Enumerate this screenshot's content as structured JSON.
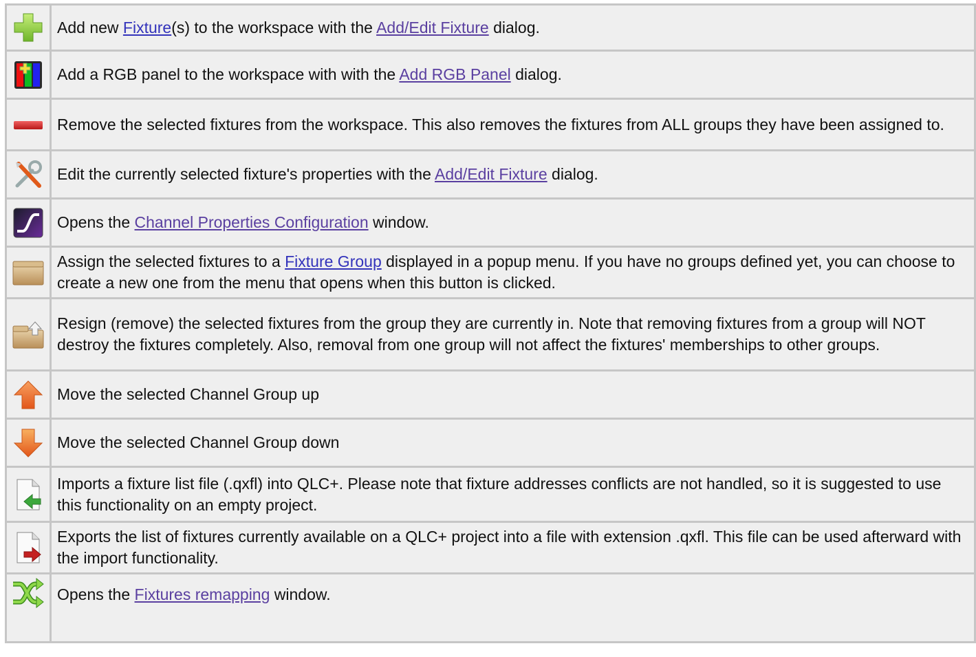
{
  "rows": [
    {
      "icon": "add-plus-icon",
      "parts": [
        "Add new ",
        "Fixture",
        "(s) to the workspace with the ",
        "Add/Edit Fixture",
        " dialog."
      ]
    },
    {
      "icon": "rgb-panel-icon",
      "parts": [
        "Add a RGB panel to the workspace with with the ",
        "Add RGB Panel",
        " dialog."
      ]
    },
    {
      "icon": "remove-minus-icon",
      "text": "Remove the selected fixtures from the workspace. This also removes the fixtures from ALL groups they have been assigned to."
    },
    {
      "icon": "configure-tools-icon",
      "parts": [
        "Edit the currently selected fixture's properties with the ",
        "Add/Edit Fixture",
        " dialog."
      ]
    },
    {
      "icon": "channel-properties-icon",
      "parts": [
        "Opens the ",
        "Channel Properties Configuration",
        " window."
      ]
    },
    {
      "icon": "group-box-icon",
      "parts": [
        "Assign the selected fixtures to a ",
        "Fixture Group",
        " displayed in a popup menu. If you have no groups defined yet, you can choose to create a new one from the menu that opens when this button is clicked."
      ]
    },
    {
      "icon": "ungroup-box-icon",
      "text": "Resign (remove) the selected fixtures from the group they are currently in. Note that removing fixtures from a group will NOT destroy the fixtures completely. Also, removal from one group will not affect the fixtures' memberships to other groups."
    },
    {
      "icon": "arrow-up-icon",
      "text": "Move the selected Channel Group up"
    },
    {
      "icon": "arrow-down-icon",
      "text": "Move the selected Channel Group down"
    },
    {
      "icon": "import-file-icon",
      "text": "Imports a fixture list file (.qxfl) into QLC+. Please note that fixture addresses conflicts are not handled, so it is suggested to use this functionality on an empty project."
    },
    {
      "icon": "export-file-icon",
      "text": "Exports the list of fixtures currently available on a QLC+ project into a file with extension .qxfl. This file can be used afterward with the import functionality."
    },
    {
      "icon": "remap-shuffle-icon",
      "parts": [
        "Opens the ",
        "Fixtures remapping",
        " window."
      ]
    }
  ]
}
